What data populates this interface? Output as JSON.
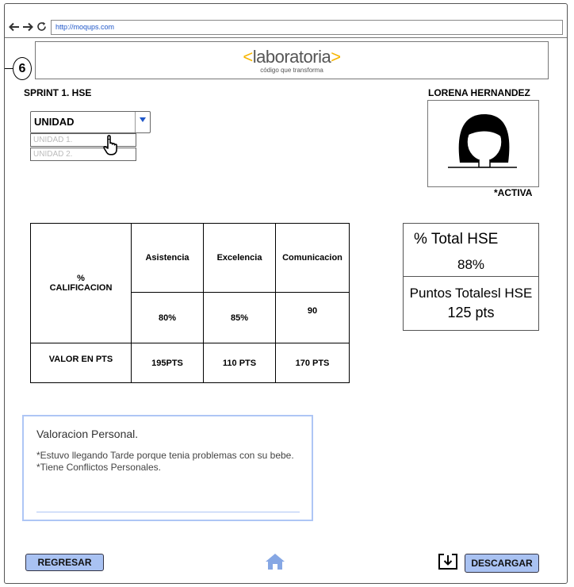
{
  "browser": {
    "url": "http://moqups.com",
    "back_icon": "arrow-left",
    "forward_icon": "arrow-right",
    "reload_icon": "reload"
  },
  "marker": {
    "number": "6"
  },
  "logo": {
    "open": "<",
    "name": "laboratoria",
    "close": ">",
    "tagline": "código que transforma"
  },
  "sprint": {
    "title": "SPRINT 1.  HSE"
  },
  "unit_select": {
    "selected": "UNIDAD",
    "options": [
      "UNIDAD 1.",
      "UNIDAD 2."
    ]
  },
  "profile": {
    "name": "LORENA HERNANDEZ",
    "status": "*ACTIVA"
  },
  "scores_table": {
    "row_header_pct": "% CALIFICACION",
    "row_header_pts": "VALOR EN PTS",
    "columns": [
      "Asistencia",
      "Excelencia",
      "Comunicacion"
    ],
    "percentages": [
      "80%",
      "85%",
      "90"
    ],
    "points": [
      "195PTS",
      "110 PTS",
      "170 PTS"
    ]
  },
  "hse_totals": {
    "pct_label": "% Total HSE",
    "pct_value": "88%",
    "pts_label": "Puntos Totalesl HSE",
    "pts_value": "125 pts"
  },
  "personal_note": {
    "title": "Valoracion Personal.",
    "lines": [
      "*Estuvo llegando Tarde porque tenia problemas con su bebe.",
      "*Tiene Conflictos Personales."
    ]
  },
  "footer": {
    "back_label": "REGRESAR",
    "download_label": "DESCARGAR",
    "home_icon": "home-icon",
    "download_icon": "download-icon"
  },
  "colors": {
    "accent_blue": "#a9c2f2",
    "link_blue": "#1f57c9",
    "logo_yellow": "#f7b500"
  }
}
